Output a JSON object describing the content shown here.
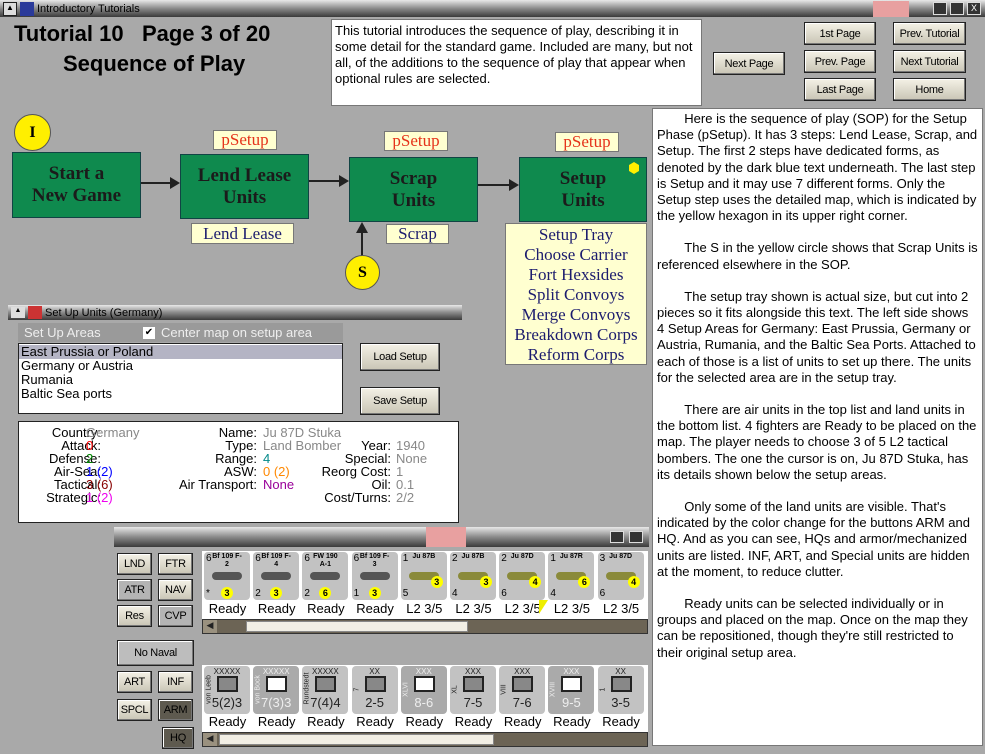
{
  "window": {
    "title": "Introductory Tutorials"
  },
  "header": {
    "title_line1": "Tutorial 10   Page 3 of 20",
    "title_line2": "Sequence of Play",
    "description": "This tutorial introduces the sequence of play, describing it in some detail for the standard game. Included are many, but not all, of the additions to the sequence of play that appear when optional rules are selected."
  },
  "nav": {
    "next_page": "Next Page",
    "first_page": "1st Page",
    "prev_tutorial": "Prev. Tutorial",
    "prev_page": "Prev. Page",
    "next_tutorial": "Next Tutorial",
    "last_page": "Last Page",
    "home": "Home"
  },
  "flow": {
    "i_marker": "I",
    "s_marker": "S",
    "start": "Start a New Game",
    "lend_lease": "Lend Lease Units",
    "scrap": "Scrap Units",
    "setup": "Setup Units",
    "phase1": "pSetup",
    "phase2": "pSetup",
    "phase3": "pSetup",
    "form_lend": "Lend Lease",
    "form_scrap": "Scrap",
    "setup_forms": [
      "Setup Tray",
      "Choose Carrier",
      "Fort Hexsides",
      "Split Convoys",
      "Merge Convoys",
      "Breakdown Corps",
      "Reform Corps"
    ]
  },
  "setup_panel": {
    "title": "Set Up Units (Germany)",
    "areas_label": "Set Up Areas",
    "center_label": "Center map on setup area",
    "center_checked": true,
    "areas": [
      "East Prussia or Poland",
      "Germany or Austria",
      "Rumania",
      "Baltic Sea ports"
    ],
    "selected_area": 0,
    "load": "Load Setup",
    "save": "Save Setup"
  },
  "info": {
    "country_k": "Country:",
    "country": "Germany",
    "attack_k": "Attack:",
    "attack": "0",
    "defense_k": "Defense:",
    "defense": "2",
    "airsea_k": "Air-Sea:",
    "airsea": "1 (2)",
    "tactical_k": "Tactical:",
    "tactical": "3 (6)",
    "strategic_k": "Strategic:",
    "strategic": "1 (2)",
    "name_k": "Name:",
    "name": "Ju 87D Stuka",
    "type_k": "Type:",
    "type": "Land Bomber",
    "range_k": "Range:",
    "range": "4",
    "asw_k": "ASW:",
    "asw": "0 (2)",
    "airtrans_k": "Air Transport:",
    "airtrans": "None",
    "year_k": "Year:",
    "year": "1940",
    "special_k": "Special:",
    "special": "None",
    "reorg_k": "Reorg Cost:",
    "reorg": "1",
    "oil_k": "Oil:",
    "oil": "0.1",
    "cost_k": "Cost/Turns:",
    "cost": "2/2"
  },
  "tray": {
    "filters": {
      "lnd": "LND",
      "ftr": "FTR",
      "atr": "ATR",
      "nav": "NAV",
      "res": "Res",
      "cvp": "CVP",
      "no_naval": "No Naval",
      "art": "ART",
      "inf": "INF",
      "spcl": "SPCL",
      "arm": "ARM",
      "hq": "HQ"
    },
    "air_units": [
      {
        "tl": "6",
        "name": "Bf 109 F-2",
        "bl": "*",
        "val": "3",
        "status": "Ready"
      },
      {
        "tl": "6",
        "name": "Bf 109 F-4",
        "bl": "2",
        "val": "3",
        "status": "Ready"
      },
      {
        "tl": "6",
        "name": "FW 190 A-1",
        "bl": "2",
        "val": "6",
        "status": "Ready"
      },
      {
        "tl": "6",
        "name": "Bf 109 F-3",
        "bl": "1",
        "val": "3",
        "status": "Ready"
      },
      {
        "tl": "1",
        "name": "Ju 87B",
        "bl": "5",
        "val": "3",
        "status": "L2 3/5"
      },
      {
        "tl": "2",
        "name": "Ju 87B",
        "bl": "4",
        "val": "3",
        "status": "L2 3/5"
      },
      {
        "tl": "2",
        "name": "Ju 87D",
        "bl": "6",
        "val": "4",
        "status": "L2 3/5"
      },
      {
        "tl": "1",
        "name": "Ju 87R",
        "bl": "4",
        "val": "6",
        "status": "L2 3/5"
      },
      {
        "tl": "3",
        "name": "Ju 87D",
        "bl": "6",
        "val": "4",
        "status": "L2 3/5"
      }
    ],
    "land_units": [
      {
        "size": "XXXXX",
        "side": "von Leeb",
        "str": "5(2)3",
        "status": "Ready"
      },
      {
        "size": "XXXXX",
        "side": "von Bock",
        "str": "7(3)3",
        "status": "Ready"
      },
      {
        "size": "XXXXX",
        "side": "Rundstedt",
        "str": "7(4)4",
        "status": "Ready"
      },
      {
        "size": "XX",
        "side": "7",
        "str": "2-5",
        "status": "Ready"
      },
      {
        "size": "XXX",
        "side": "XLVI",
        "str": "8-6",
        "status": "Ready"
      },
      {
        "size": "XXX",
        "side": "XL",
        "str": "7-5",
        "status": "Ready"
      },
      {
        "size": "XXX",
        "side": "VIII",
        "str": "7-6",
        "status": "Ready"
      },
      {
        "size": "XXX",
        "side": "XVIII",
        "str": "9-5",
        "status": "Ready"
      },
      {
        "size": "XX",
        "side": "1",
        "str": "3-5",
        "status": "Ready"
      }
    ]
  },
  "sop_text": [
    "Here is the sequence of play (SOP) for the Setup Phase (pSetup).  It has 3 steps: Lend Lease, Scrap, and Setup.  The first 2 steps have dedicated forms, as denoted by the dark blue text underneath.  The last step is Setup and it may use 7 different forms.  Only the Setup step uses the detailed map, which is indicated by the yellow hexagon in its upper right corner.",
    "The S in the yellow circle shows that Scrap Units is referenced elsewhere in the SOP.",
    "The setup tray shown is actual size, but cut into 2 pieces so it fits alongside this text.  The left side shows 4 Setup Areas for Germany: East Prussia, Germany or Austria, Rumania, and the Baltic Sea Ports.  Attached to each of those is a list of units to set up there.  The units for the selected area are in the setup tray.",
    "There are air units in the top list and land units in the bottom list.  4 fighters are Ready to be placed on the map.  The player needs to choose 3 of 5 L2 tactical bombers.  The one the cursor is on, Ju 87D Stuka, has its details shown below the setup areas.",
    "Only some of the land units are visible.  That's indicated by the color change for the buttons ARM and HQ.  And as you can see, HQs and armor/mechanized units are listed.  INF, ART, and Special units are hidden at the moment, to reduce clutter.",
    "Ready units can be selected individually or in groups and placed on the map.  Once on the map they can be repositioned, though they're still restricted to their original setup area."
  ]
}
